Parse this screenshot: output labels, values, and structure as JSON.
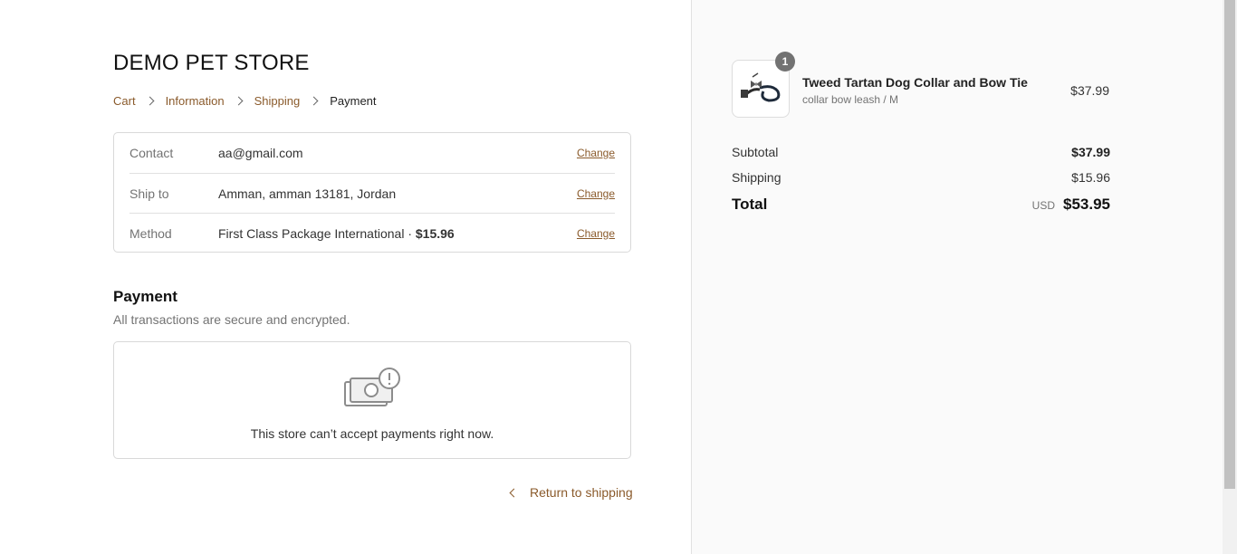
{
  "store": {
    "title": "DEMO PET STORE"
  },
  "breadcrumb": [
    {
      "label": "Cart"
    },
    {
      "label": "Information"
    },
    {
      "label": "Shipping"
    },
    {
      "label": "Payment"
    }
  ],
  "review": {
    "rows": [
      {
        "label": "Contact",
        "value": "aa@gmail.com",
        "action": "Change"
      },
      {
        "label": "Ship to",
        "value": "Amman, amman 13181, Jordan",
        "action": "Change"
      },
      {
        "label": "Method",
        "value": "First Class Package International · ",
        "value_bold": "$15.96",
        "action": "Change"
      }
    ]
  },
  "payment": {
    "heading": "Payment",
    "subtitle": "All transactions are secure and encrypted.",
    "icon": "cash-warning-icon",
    "message": "This store can’t accept payments right now."
  },
  "return_link": {
    "label": "Return to shipping",
    "icon": "chevron-left-icon"
  },
  "summary": {
    "product": {
      "quantity": "1",
      "name": "Tweed Tartan Dog Collar and Bow Tie",
      "variant": "collar bow leash / M",
      "price": "$37.99"
    },
    "subtotal": {
      "label": "Subtotal",
      "amount": "$37.99"
    },
    "shipping": {
      "label": "Shipping",
      "amount": "$15.96"
    },
    "total": {
      "label": "Total",
      "currency": "USD",
      "amount": "$53.95"
    }
  },
  "colors": {
    "accent": "#8a5a2b",
    "sidebar_bg": "#fafafa",
    "border": "#d9d9d9"
  }
}
